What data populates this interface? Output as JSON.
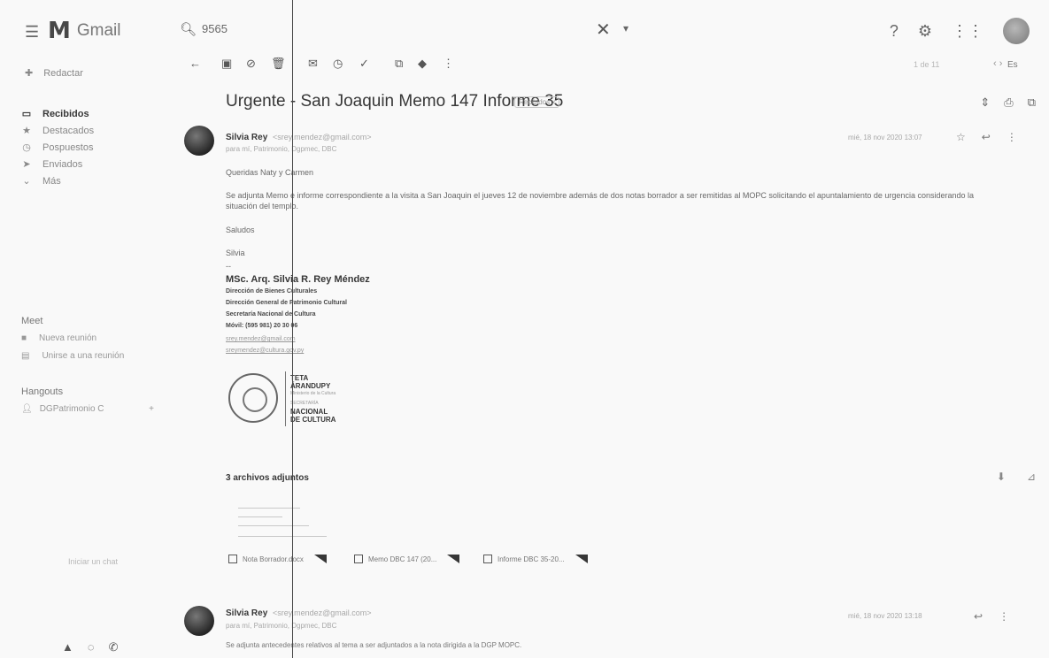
{
  "app": {
    "name": "Gmail"
  },
  "search": {
    "query": "9565"
  },
  "top_icons": [
    "help-icon",
    "gear-icon",
    "apps-icon",
    "avatar"
  ],
  "sidebar": {
    "compose_label": "Redactar",
    "items": [
      {
        "label": "Recibidos",
        "icon": "inbox-icon",
        "active": true
      },
      {
        "label": "Destacados",
        "icon": "star-icon",
        "active": false
      },
      {
        "label": "Pospuestos",
        "icon": "clock-icon",
        "active": false
      },
      {
        "label": "Enviados",
        "icon": "send-icon",
        "active": false
      },
      {
        "label": "Más",
        "icon": "chevron-down-icon",
        "active": false
      }
    ],
    "meet": {
      "title": "Meet",
      "items": [
        {
          "label": "Nueva reunión",
          "icon": "video-icon"
        },
        {
          "label": "Unirse a una reunión",
          "icon": "keyboard-icon"
        }
      ]
    },
    "hangouts": {
      "title": "Hangouts",
      "user": "DGPatrimonio C",
      "plus": "+"
    },
    "start_chat": "Iniciar un chat"
  },
  "toolbar": {
    "pager": "1 de 11",
    "lang": "Es"
  },
  "email": {
    "subject": "Urgente - San Joaquin Memo 147 Informe 35",
    "label": "Recibidos x",
    "message1": {
      "sender": "Silvia Rey",
      "sender_email": "<srey.mendez@gmail.com>",
      "to": "para mí, Patrimonio, Dgpmec, DBC",
      "date": "mié, 18 nov 2020 13:07",
      "greeting": "Queridas Naty y Carmen",
      "body_line1": "Se adjunta Memo e informe correspondiente a la visita a San Joaquin el jueves 12 de noviembre además de dos notas borrador a ser remitidas al MOPC solicitando el apuntalamiento de urgencia considerando la",
      "body_line2": "situación del templo.",
      "saludos": "Saludos",
      "short_sign": "Silvia",
      "dash": "--",
      "sig_name": "MSc. Arq. Silvia R. Rey Méndez",
      "sig_lines": [
        "Dirección de Bienes Culturales",
        "Dirección General de Patrimonio Cultural",
        "Secretaría Nacional de Cultura",
        "Móvil: (595 981) 20 30 06"
      ],
      "sig_links": [
        "srey.mendez@gmail.com",
        "sreymendez@cultura.gov.py"
      ],
      "logo_text_top": [
        "TETA",
        "ÁRANDUPY",
        "Ministerio de la Cultura"
      ],
      "logo_text_bottom": [
        "SECRETARÍA",
        "NACIONAL",
        "DE CULTURA"
      ]
    },
    "attachments": {
      "title": "3 archivos adjuntos",
      "files": [
        "Nota Borrador.docx",
        "Memo DBC 147 (20...",
        "Informe DBC 35-20..."
      ]
    },
    "message2": {
      "sender": "Silvia Rey",
      "sender_email": "<srey.mendez@gmail.com>",
      "to": "para mí, Patrimonio, Dgpmec, DBC",
      "date": "mié, 18 nov 2020 13:18",
      "body": "Se adjunta antecedentes relativos al tema a ser adjuntados a la nota dirigida a la DGP MOPC."
    }
  }
}
